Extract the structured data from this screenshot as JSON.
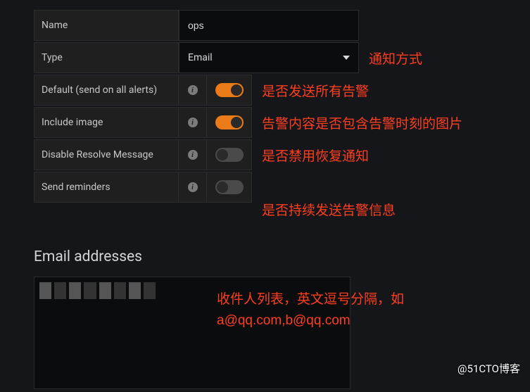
{
  "form": {
    "name_label": "Name",
    "name_value": "ops",
    "type_label": "Type",
    "type_value": "Email",
    "type_annot": "通知方式",
    "rows": [
      {
        "label": "Default (send on all alerts)",
        "on": true,
        "annot": "是否发送所有告警"
      },
      {
        "label": "Include image",
        "on": true,
        "annot": "告警内容是否包含告警时刻的图片"
      },
      {
        "label": "Disable Resolve Message",
        "on": false,
        "annot": "是否禁用恢复通知"
      },
      {
        "label": "Send reminders",
        "on": false,
        "annot": "是否持续发送告警信息"
      }
    ]
  },
  "email": {
    "heading": "Email addresses",
    "annot_line1": "收件人列表，英文逗号分隔，如",
    "annot_line2": "a@qq.com,b@qq.com"
  },
  "watermark": "@51CTO博客"
}
